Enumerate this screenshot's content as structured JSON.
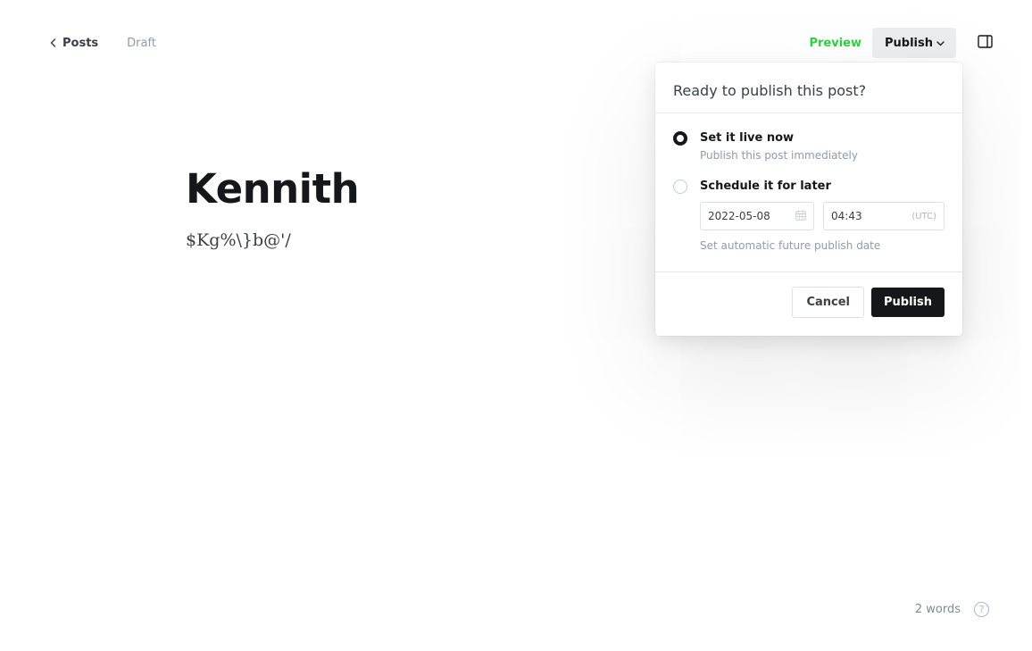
{
  "nav": {
    "back_label": "Posts",
    "status": "Draft"
  },
  "toolbar": {
    "preview_label": "Preview",
    "publish_label": "Publish"
  },
  "editor": {
    "title": "Kennith",
    "body": "$Kg%\\}b@'/"
  },
  "publish_menu": {
    "heading": "Ready to publish this post?",
    "options": [
      {
        "title": "Set it live now",
        "description": "Publish this post immediately",
        "selected": true
      },
      {
        "title": "Schedule it for later",
        "selected": false
      }
    ],
    "schedule": {
      "date": "2022-05-08",
      "time": "04:43",
      "timezone": "(UTC)",
      "hint": "Set automatic future publish date"
    },
    "cancel_label": "Cancel",
    "publish_label": "Publish"
  },
  "footer": {
    "word_count": "2 words",
    "help_glyph": "?"
  },
  "colors": {
    "accent_green": "#30cf43",
    "primary_dark": "#15171a",
    "muted_text": "#8e9cac"
  },
  "icons": {
    "back": "chevron-left-icon",
    "publish_caret": "chevron-down-icon",
    "sidebar": "sidebar-panel-icon",
    "calendar": "calendar-icon",
    "help": "help-circle-icon"
  }
}
